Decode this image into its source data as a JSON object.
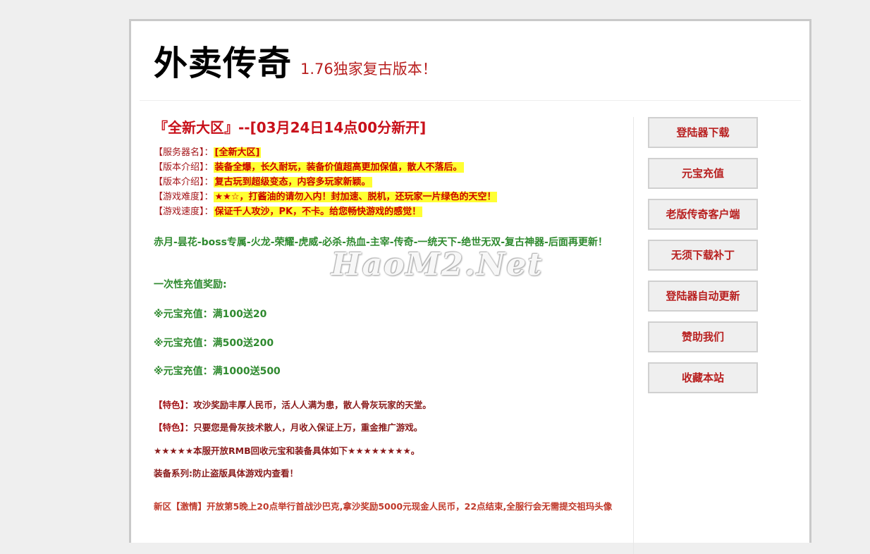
{
  "header": {
    "title": "外卖传奇",
    "subtitle": "1.76独家复古版本！"
  },
  "main": {
    "headline": "『全新大区』--[03月24日14点00分新开]",
    "info": [
      {
        "label": "【服务器名】：",
        "value": "[全新大区]"
      },
      {
        "label": "【版本介绍】：",
        "value": "装备全爆，长久耐玩，装备价值超高更加保值，散人不落后。"
      },
      {
        "label": "【版本介绍】：",
        "value": "复古玩到超级变态，内容多玩家新颖。"
      },
      {
        "label": "【游戏难度】：",
        "value": "★★☆，打酱油的请勿入内！封加速、脱机，还玩家一片绿色的天空！"
      },
      {
        "label": "【游戏速度】：",
        "value": "保证千人攻沙，PK，不卡。给您畅快游戏的感觉！"
      }
    ],
    "bosses": "赤月-昙花-boss专属-火龙-荣耀-虎威-必杀-热血-主宰-传奇-一统天下-绝世无双-复古神器-后面再更新！",
    "bonus_title": "一次性充值奖励:",
    "recharge": [
      "※元宝充值：满100送20",
      "※元宝充值：满500送200",
      "※元宝充值：满1000送500"
    ],
    "features": [
      {
        "bracket": "【特色】",
        "text": "：攻沙奖励丰厚人民币，活人人满为患，散人骨灰玩家的天堂。"
      },
      {
        "bracket": "【特色】",
        "text": "：只要您是骨灰技术散人，月收入保证上万，重金推广游戏。"
      }
    ],
    "notice1": "★★★★★本服开放RMB回收元宝和装备具体如下★★★★★★★★。",
    "notice2": "装备系列:防止盗版具体游戏内查看！",
    "promo": "新区【激情】开放第5晚上20点举行首战沙巴克,拿沙奖励5000元现金人民币，22点结束,全服行会无需提交祖玛头像"
  },
  "sidebar": {
    "buttons": [
      "登陆器下载",
      "元宝充值",
      "老版传奇客户端",
      "无须下载补丁",
      "登陆器自动更新",
      "赞助我们",
      "收藏本站"
    ]
  },
  "watermark": "HaoM2.Net"
}
